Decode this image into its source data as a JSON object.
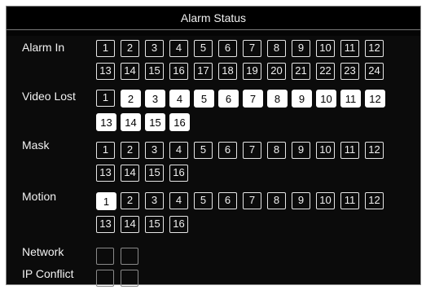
{
  "window": {
    "title": "Alarm Status"
  },
  "rows": [
    {
      "label": "Alarm In",
      "channels": [
        "1",
        "2",
        "3",
        "4",
        "5",
        "6",
        "7",
        "8",
        "9",
        "10",
        "11",
        "12",
        "13",
        "14",
        "15",
        "16",
        "17",
        "18",
        "19",
        "20",
        "21",
        "22",
        "23",
        "24"
      ],
      "active": []
    },
    {
      "label": "Video Lost",
      "channels": [
        "1",
        "2",
        "3",
        "4",
        "5",
        "6",
        "7",
        "8",
        "9",
        "10",
        "11",
        "12",
        "13",
        "14",
        "15",
        "16"
      ],
      "active": [
        "2",
        "3",
        "4",
        "5",
        "6",
        "7",
        "8",
        "9",
        "10",
        "11",
        "12",
        "13",
        "14",
        "15",
        "16"
      ]
    },
    {
      "label": "Mask",
      "channels": [
        "1",
        "2",
        "3",
        "4",
        "5",
        "6",
        "7",
        "8",
        "9",
        "10",
        "11",
        "12",
        "13",
        "14",
        "15",
        "16"
      ],
      "active": []
    },
    {
      "label": "Motion",
      "channels": [
        "1",
        "2",
        "3",
        "4",
        "5",
        "6",
        "7",
        "8",
        "9",
        "10",
        "11",
        "12",
        "13",
        "14",
        "15",
        "16"
      ],
      "active": [
        "1"
      ]
    },
    {
      "label": "Network",
      "channels": [
        "",
        ""
      ],
      "active": []
    },
    {
      "label": "IP Conflict",
      "channels": [
        "",
        ""
      ],
      "active": []
    }
  ]
}
